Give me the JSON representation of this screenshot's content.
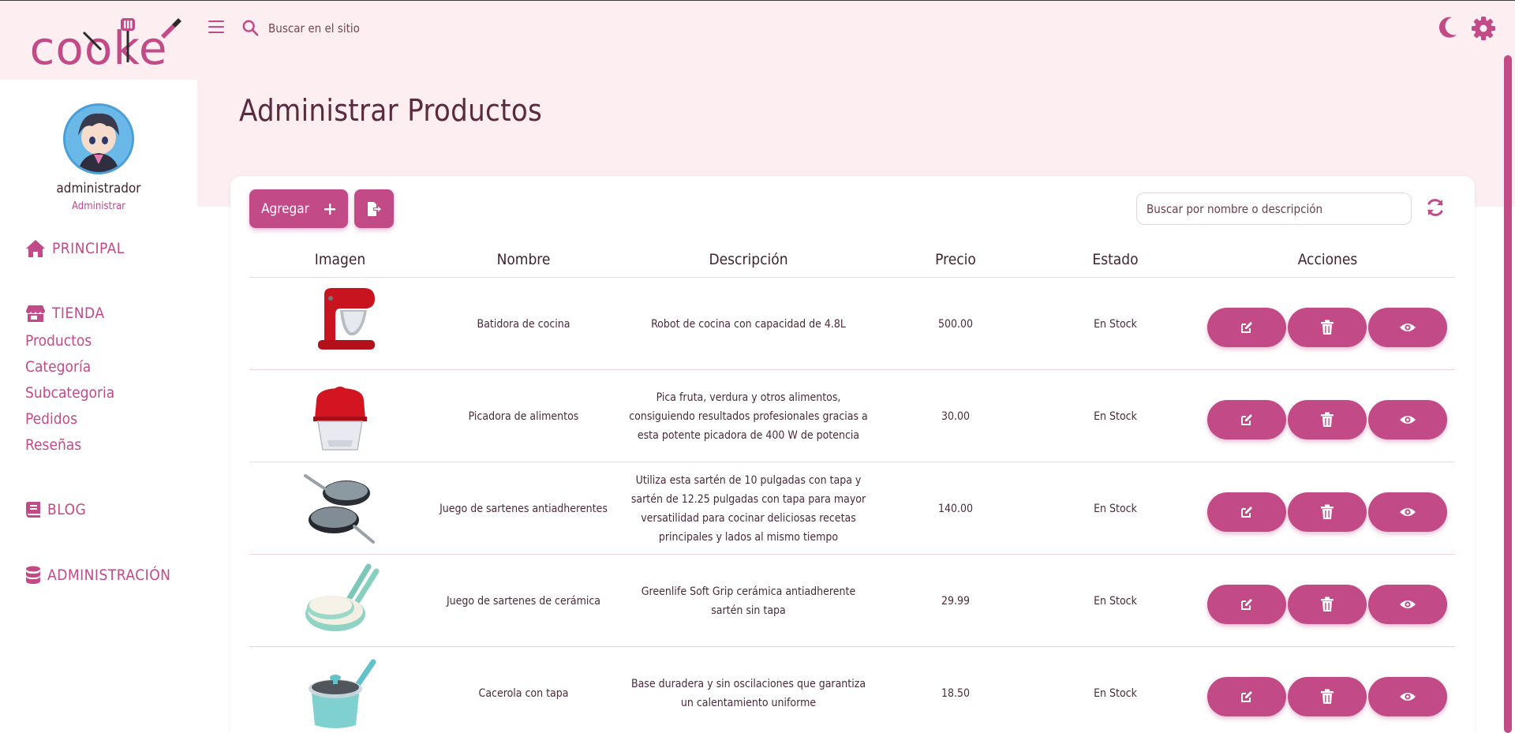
{
  "brand": {
    "logo_text": "cooke",
    "accent": "#c24a86",
    "bg": "#fdeef1"
  },
  "header": {
    "search_placeholder": "Buscar en el sitio"
  },
  "user": {
    "name": "administrador",
    "role": "Administrar"
  },
  "sidebar": {
    "principal": "PRINCIPAL",
    "tienda": "TIENDA",
    "tienda_links": [
      "Productos",
      "Categoría",
      "Subcategoria",
      "Pedidos",
      "Reseñas"
    ],
    "blog": "BLOG",
    "administracion": "ADMINISTRACIÓN"
  },
  "page": {
    "title": "Administrar Productos"
  },
  "toolbar": {
    "add_label": "Agregar",
    "search_placeholder": "Buscar por nombre o descripción"
  },
  "table": {
    "headers": [
      "Imagen",
      "Nombre",
      "Descripción",
      "Precio",
      "Estado",
      "Acciones"
    ],
    "rows": [
      {
        "image": "stand-mixer",
        "name": "Batidora de cocina",
        "description": "Robot de cocina con capacidad de 4.8L",
        "price": "500.00",
        "status": "En Stock"
      },
      {
        "image": "food-chopper",
        "name": "Picadora de alimentos",
        "description": "Pica fruta, verdura y otros alimentos, consiguiendo resultados profesionales gracias a esta potente picadora de 400 W de potencia",
        "price": "30.00",
        "status": "En Stock"
      },
      {
        "image": "nonstick-pans",
        "name": "Juego de sartenes antiadherentes",
        "description": "Utiliza esta sartén de 10 pulgadas con tapa y sartén de 12.25 pulgadas con tapa para mayor versatilidad para cocinar deliciosas recetas principales y lados al mismo tiempo",
        "price": "140.00",
        "status": "En Stock"
      },
      {
        "image": "ceramic-pans",
        "name": "Juego de sartenes de cerámica",
        "description": "Greenlife Soft Grip cerámica antiadherente sartén sin tapa",
        "price": "29.99",
        "status": "En Stock"
      },
      {
        "image": "saucepan",
        "name": "Cacerola con tapa",
        "description": "Base duradera y sin oscilaciones que garantiza un calentamiento uniforme",
        "price": "18.50",
        "status": "En Stock"
      }
    ]
  }
}
